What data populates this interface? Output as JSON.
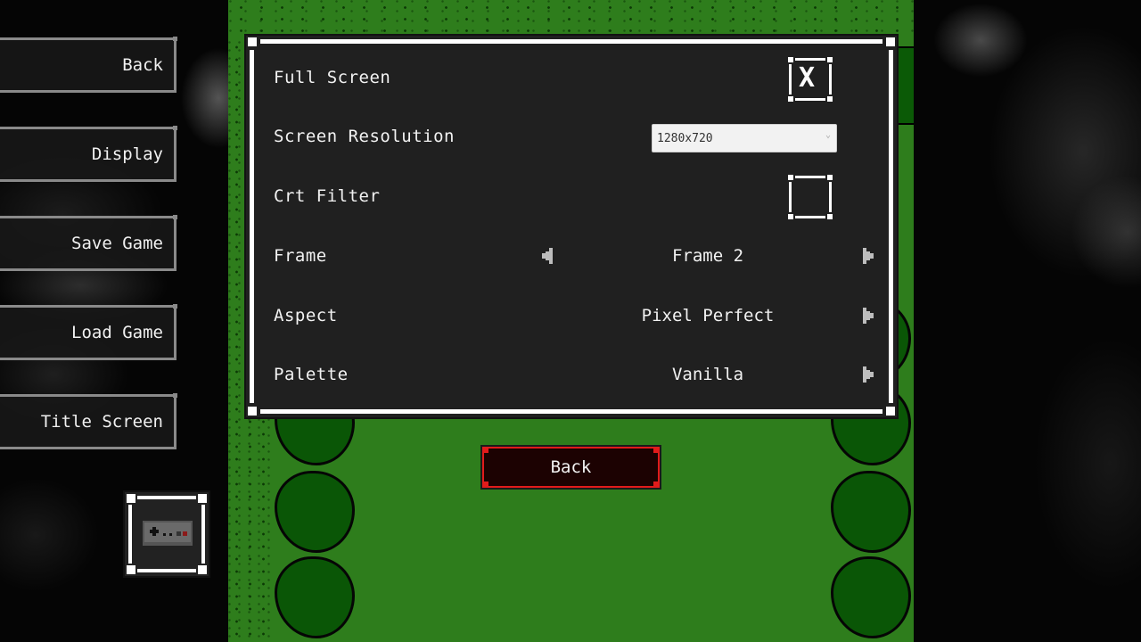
{
  "side_menu": {
    "items": [
      {
        "label": "Back"
      },
      {
        "label": "Display"
      },
      {
        "label": "Save Game"
      },
      {
        "label": "Load Game"
      },
      {
        "label": "Title Screen"
      }
    ],
    "gamepad_icon": "gamepad-icon"
  },
  "settings": {
    "full_screen": {
      "label": "Full Screen",
      "checked": true,
      "mark": "X"
    },
    "screen_resolution": {
      "label": "Screen Resolution",
      "value": "1280x720",
      "caret": "⌄"
    },
    "crt_filter": {
      "label": "Crt Filter",
      "checked": false
    },
    "frame": {
      "label": "Frame",
      "value": "Frame 2"
    },
    "aspect": {
      "label": "Aspect",
      "value": "Pixel Perfect"
    },
    "palette": {
      "label": "Palette",
      "value": "Vanilla"
    }
  },
  "back_button": {
    "label": "Back"
  },
  "colors": {
    "grass": "#2e7d1c",
    "tree": "#0a5606",
    "panel": "#202020",
    "back_accent": "#e11b1b"
  }
}
